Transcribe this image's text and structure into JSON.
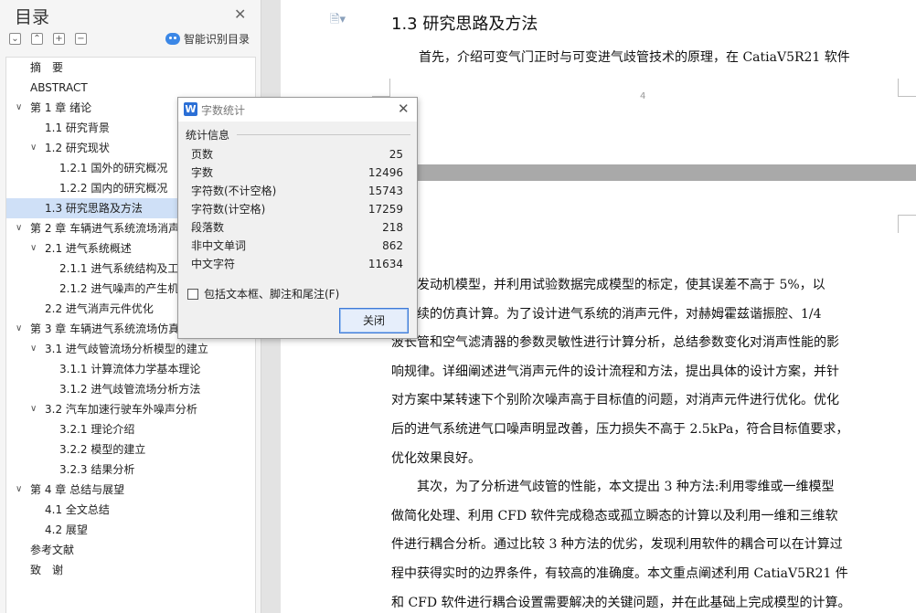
{
  "sidebar": {
    "title": "目录",
    "close_icon": "✕",
    "tools": [
      {
        "name": "collapse-all",
        "glyph": "⌄"
      },
      {
        "name": "expand-all",
        "glyph": "⌃"
      },
      {
        "name": "add-heading",
        "glyph": "+"
      },
      {
        "name": "remove-heading",
        "glyph": "−"
      }
    ],
    "smart_label": "智能识别目录",
    "toc": [
      {
        "label": "摘　要",
        "level": 0,
        "expandable": false
      },
      {
        "label": "ABSTRACT",
        "level": 0,
        "expandable": false
      },
      {
        "label": "第 1 章  绪论",
        "level": 0,
        "expandable": true
      },
      {
        "label": "1.1 研究背景",
        "level": 1,
        "expandable": false
      },
      {
        "label": "1.2 研究现状",
        "level": 1,
        "expandable": true
      },
      {
        "label": "1.2.1 国外的研究概况",
        "level": 2,
        "expandable": false
      },
      {
        "label": "1.2.2 国内的研究概况",
        "level": 2,
        "expandable": false
      },
      {
        "label": "1.3 研究思路及方法",
        "level": 1,
        "expandable": false,
        "selected": true
      },
      {
        "label": "第 2 章  车辆进气系统流场消声",
        "level": 0,
        "expandable": true
      },
      {
        "label": "2.1 进气系统概述",
        "level": 1,
        "expandable": true
      },
      {
        "label": "2.1.1 进气系统结构及工作",
        "level": 2,
        "expandable": false
      },
      {
        "label": "2.1.2 进气噪声的产生机理",
        "level": 2,
        "expandable": false
      },
      {
        "label": "2.2 进气消声元件优化",
        "level": 1,
        "expandable": false
      },
      {
        "label": "第 3 章  车辆进气系统流场仿真",
        "level": 0,
        "expandable": true
      },
      {
        "label": "3.1 进气歧管流场分析模型的建立",
        "level": 1,
        "expandable": true
      },
      {
        "label": "3.1.1 计算流体力学基本理论",
        "level": 2,
        "expandable": false
      },
      {
        "label": "3.1.2 进气歧管流场分析方法",
        "level": 2,
        "expandable": false
      },
      {
        "label": "3.2 汽车加速行驶车外噪声分析",
        "level": 1,
        "expandable": true
      },
      {
        "label": "3.2.1 理论介绍",
        "level": 2,
        "expandable": false
      },
      {
        "label": "3.2.2 模型的建立",
        "level": 2,
        "expandable": false
      },
      {
        "label": "3.2.3 结果分析",
        "level": 2,
        "expandable": false
      },
      {
        "label": "第 4 章  总结与展望",
        "level": 0,
        "expandable": true
      },
      {
        "label": "4.1 全文总结",
        "level": 1,
        "expandable": false
      },
      {
        "label": "4.2 展望",
        "level": 1,
        "expandable": false
      },
      {
        "label": "参考文献",
        "level": 0,
        "expandable": false
      },
      {
        "label": "致　谢",
        "level": 0,
        "expandable": false
      }
    ]
  },
  "document": {
    "heading": "1.3 研究思路及方法",
    "page_number": "4",
    "top_line": "首先，介绍可变气门正时与可变进气歧管技术的原理，在 CatiaV5R21 软件",
    "lines": [
      "建立发动机模型，并利用试验数据完成模型的标定，使其误差不高于 5%，以",
      "便后续的仿真计算。为了设计进气系统的消声元件，对赫姆霍兹谐振腔、1/4",
      "波长管和空气滤清器的参数灵敏性进行计算分析，总结参数变化对消声性能的影",
      "响规律。详细阐述进气消声元件的设计流程和方法，提出具体的设计方案，并针",
      "对方案中某转速下个别阶次噪声高于目标值的问题，对消声元件进行优化。优化",
      "后的进气系统进气口噪声明显改善，压力损失不高于 2.5kPa，符合目标值要求，",
      "优化效果良好。",
      "　　其次，为了分析进气歧管的性能，本文提出 3 种方法:利用零维或一维模型",
      "做简化处理、利用 CFD 软件完成稳态或孤立瞬态的计算以及利用一维和三维软",
      "件进行耦合分析。通过比较 3 种方法的优劣，发现利用软件的耦合可以在计算过",
      "程中获得实时的边界条件，有较高的准确度。本文重点阐述利用 CatiaV5R21 件",
      "和 CFD 软件进行耦合设置需要解决的关键问题，并在此基础上完成模型的计算。"
    ]
  },
  "dialog": {
    "title": "字数统计",
    "logo": "W",
    "close_icon": "✕",
    "section": "统计信息",
    "stats": [
      {
        "label": "页数",
        "value": "25"
      },
      {
        "label": "字数",
        "value": "12496"
      },
      {
        "label": "字符数(不计空格)",
        "value": "15743"
      },
      {
        "label": "字符数(计空格)",
        "value": "17259"
      },
      {
        "label": "段落数",
        "value": "218"
      },
      {
        "label": "非中文单词",
        "value": "862"
      },
      {
        "label": "中文字符",
        "value": "11634"
      }
    ],
    "include_label": "包括文本框、脚注和尾注(F)",
    "include_checked": false,
    "close_button": "关闭"
  }
}
